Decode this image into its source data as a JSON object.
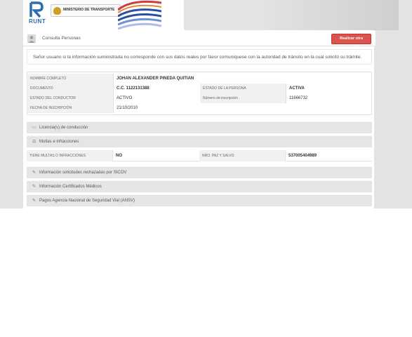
{
  "header": {
    "runt_text": "RUNT",
    "ministry_text": "MINISTERIO DE TRANSPORTE",
    "colors": {
      "runt_blue": "#2c6db2",
      "wave_blue": "#2a4fa8",
      "wave_red": "#d23c3c"
    }
  },
  "topbar": {
    "title": "Consulta Personas",
    "new_query_label": "Realizar otra consulta",
    "user_icon": "user-icon",
    "button_color": "#d9534f"
  },
  "notice": "Señor usuario si la información suministrada no corresponde con sus datos reales por favor comuníquese con la autoridad de tránsito en la cual solicitó su trámite.",
  "person": {
    "name_label": "NOMBRE COMPLETO",
    "name_value": "JOHAN ALEXANDER PINEDA QUITIAN",
    "doc_label": "DOCUMENTO",
    "doc_value": "C.C. 1122131388",
    "person_status_label": "ESTADO DE LA PERSONA",
    "person_status_value": "ACTIVA",
    "driver_status_label": "ESTADO DEL CONDUCTOR",
    "driver_status_value": "ACTIVO",
    "registration_label": "Número de inscripción",
    "registration_value": "11666732",
    "registration_date_label": "FECHA DE INSCRIPCIÓN",
    "registration_date_value": "21/10/2010"
  },
  "sections": {
    "licenses": "Licencia(s) de conducción",
    "fines": "Multas e infracciones",
    "sicov": "Información solicitudes rechazadas por SICOV",
    "medical": "Información Certificados Médicos",
    "ansv": "Pagos Agencia Nacional de Seguridad Vial (ANSV)"
  },
  "fines": {
    "has_fines_label": "TIENE MULTAS O INFRACCIONES",
    "has_fines_value": "NO",
    "paz_label": "NRO. PAZ Y SALVO",
    "paz_value": "537005404989"
  }
}
